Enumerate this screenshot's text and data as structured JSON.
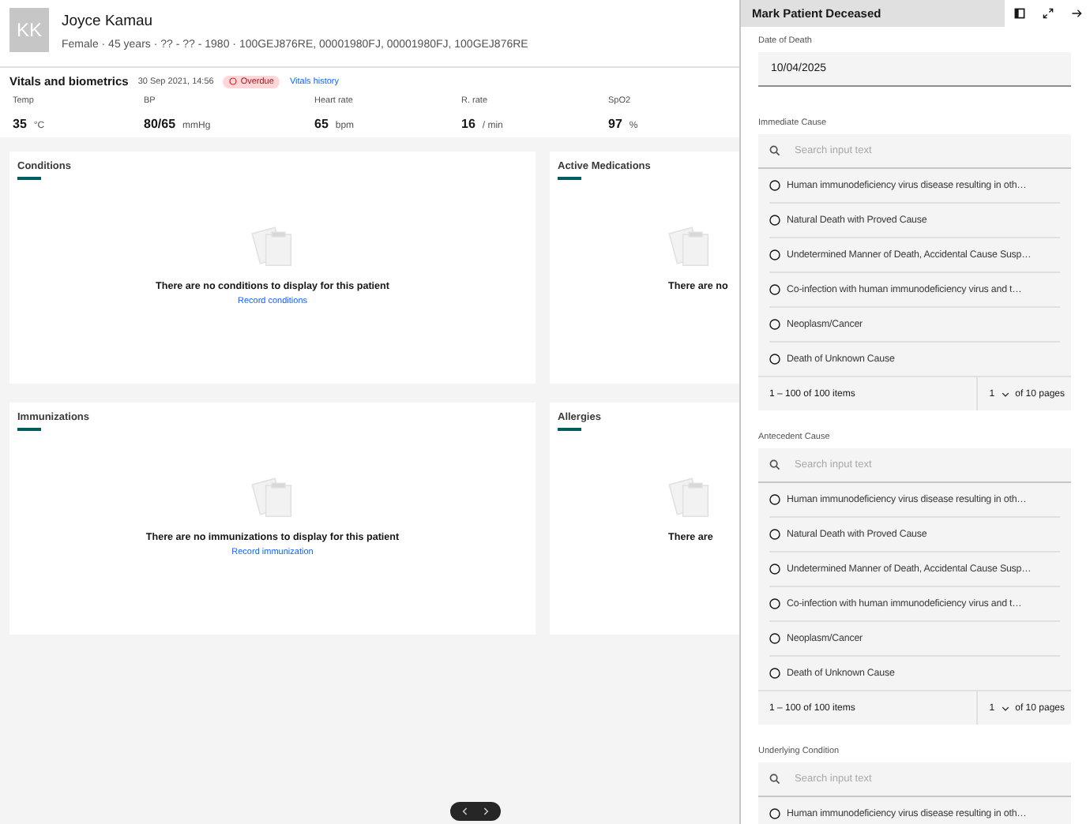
{
  "patient": {
    "initials": "KK",
    "name": "Joyce Kamau",
    "details": "Female · 45 years · ?? - ?? - 1980 · 100GEJ876RE, 00001980FJ, 00001980FJ, 100GEJ876RE"
  },
  "vitals": {
    "title": "Vitals and biometrics",
    "date": "30 Sep 2021, 14:56",
    "badge": "Overdue",
    "link": "Vitals history",
    "items": [
      {
        "label": "Temp",
        "value": "35",
        "unit": "°C"
      },
      {
        "label": "BP",
        "value": "80/65",
        "unit": "mmHg"
      },
      {
        "label": "Heart rate",
        "value": "65",
        "unit": "bpm"
      },
      {
        "label": "R. rate",
        "value": "16",
        "unit": "/ min"
      },
      {
        "label": "SpO2",
        "value": "97",
        "unit": "%"
      }
    ]
  },
  "cards": [
    {
      "title": "Conditions",
      "message": "There are no conditions to display for this patient",
      "link": "Record conditions"
    },
    {
      "title": "Active Medications",
      "message": "There are no"
    },
    {
      "title": "Immunizations",
      "message": "There are no immunizations to display for this patient",
      "link": "Record immunization"
    },
    {
      "title": "Allergies",
      "message": "There are"
    }
  ],
  "panel": {
    "title": "Mark Patient Deceased",
    "date_field": {
      "label": "Date of Death",
      "value": "10/04/2025"
    },
    "sections": [
      {
        "label": "Immediate Cause",
        "placeholder": "Search input text",
        "options": [
          {
            "label": "Human immunodeficiency virus disease resulting in oth…",
            "selected": false
          },
          {
            "label": "Natural Death with Proved Cause",
            "selected": false
          },
          {
            "label": "Undetermined Manner of Death, Accidental Cause Susp…",
            "selected": false
          },
          {
            "label": "Co-infection with human immunodeficiency virus and t…",
            "selected": false
          },
          {
            "label": "Neoplasm/Cancer",
            "selected": false
          },
          {
            "label": "Death of Unknown Cause",
            "selected": false
          }
        ],
        "pager": {
          "range": "1 – 100 of 100 items",
          "page": "1",
          "pages": "of 10 pages"
        }
      },
      {
        "label": "Antecedent Cause",
        "placeholder": "Search input text",
        "options": [
          {
            "label": "Human immunodeficiency virus disease resulting in oth…",
            "selected": false
          },
          {
            "label": "Natural Death with Proved Cause",
            "selected": false
          },
          {
            "label": "Undetermined Manner of Death, Accidental Cause Susp…",
            "selected": false
          },
          {
            "label": "Co-infection with human immunodeficiency virus and t…",
            "selected": false
          },
          {
            "label": "Neoplasm/Cancer",
            "selected": false
          },
          {
            "label": "Death of Unknown Cause",
            "selected": false
          }
        ],
        "pager": {
          "range": "1 – 100 of 100 items",
          "page": "1",
          "pages": "of 10 pages"
        }
      },
      {
        "label": "Underlying Condition",
        "placeholder": "Search input text",
        "options": [
          {
            "label": "Human immunodeficiency virus disease resulting in oth…",
            "selected": false
          }
        ]
      }
    ]
  }
}
